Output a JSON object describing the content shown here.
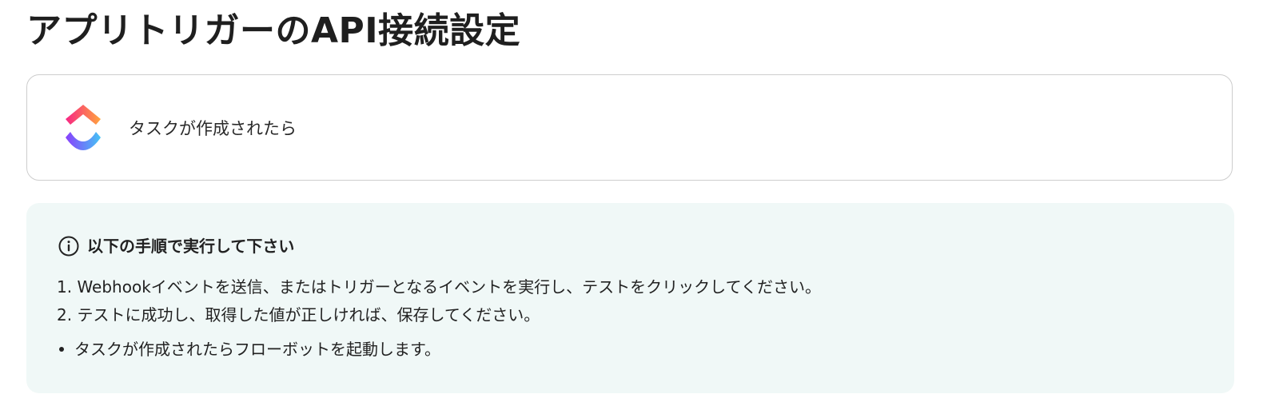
{
  "page": {
    "title": "アプリトリガーのAPI接続設定"
  },
  "trigger": {
    "app_icon": "clickup-logo-icon",
    "label": "タスクが作成されたら"
  },
  "instructions": {
    "icon": "info-circle-icon",
    "heading": "以下の手順で実行して下さい",
    "steps": [
      "1. Webhookイベントを送信、またはトリガーとなるイベントを実行し、テストをクリックしてください。",
      "2. テストに成功し、取得した値が正しければ、保存してください。"
    ],
    "notes": [
      "タスクが作成されたらフローボットを起動します。"
    ]
  },
  "colors": {
    "panel_background": "#f0f8f7",
    "card_border": "#cdcdcd",
    "logo_gradient_top": [
      "#f72585",
      "#ff9f1c"
    ],
    "logo_gradient_bottom": [
      "#7b2ff7",
      "#4cc9f0"
    ]
  }
}
